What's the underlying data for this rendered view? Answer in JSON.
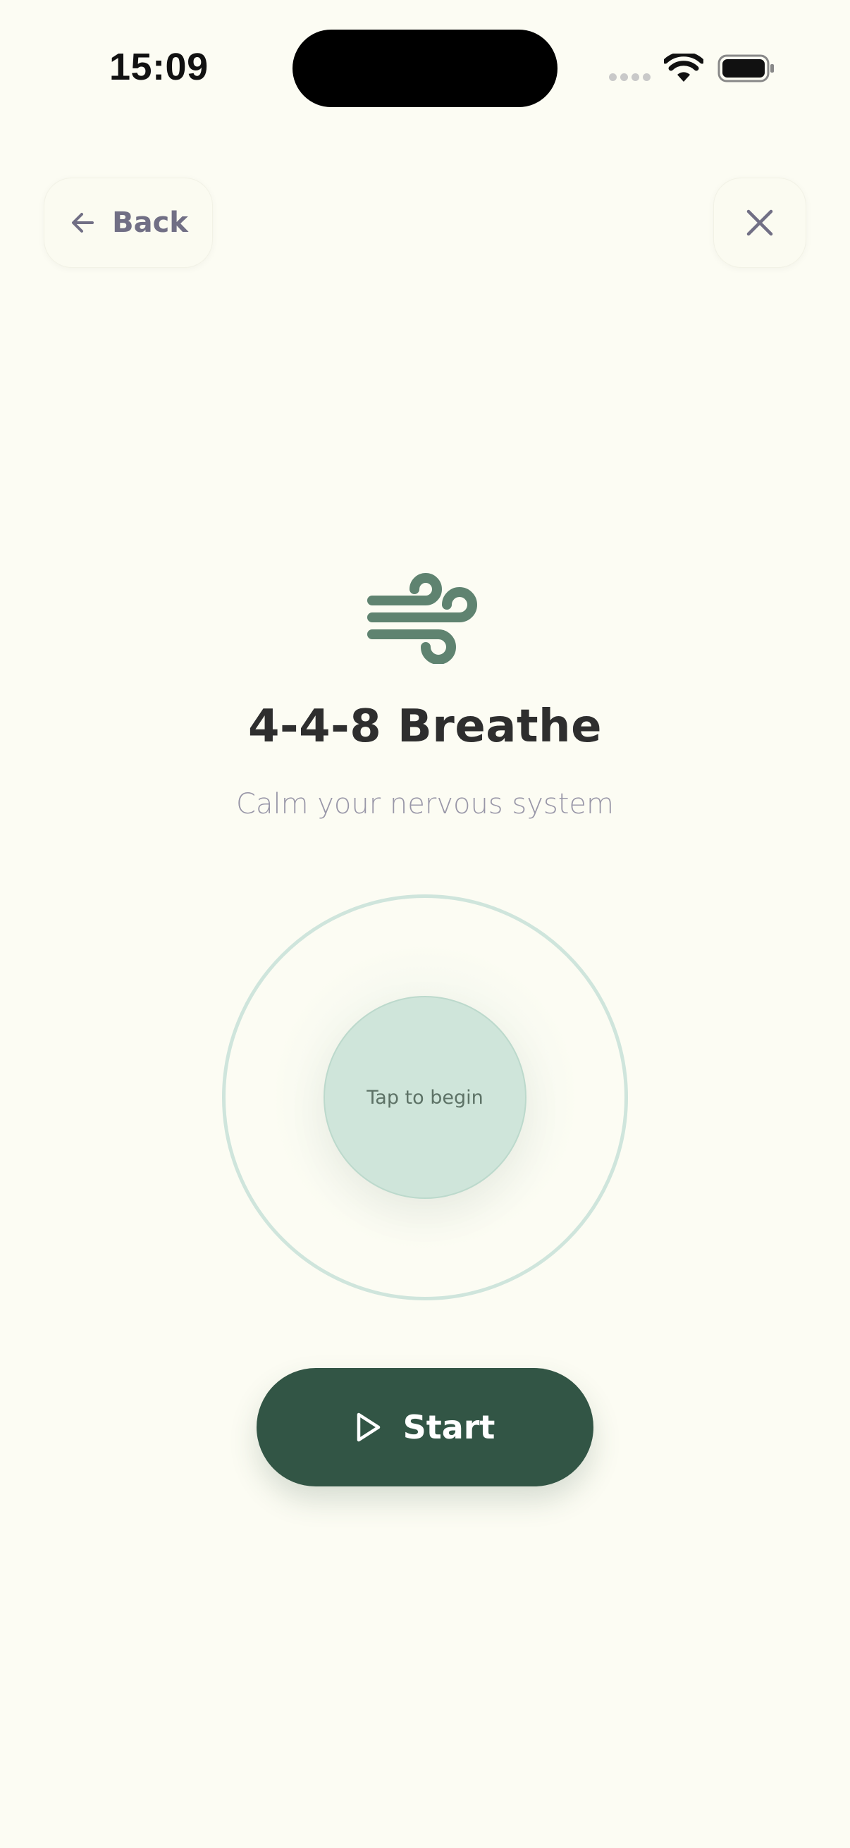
{
  "status_bar": {
    "time": "15:09"
  },
  "header": {
    "back_label": "Back",
    "back_icon": "arrow-left-icon",
    "close_icon": "close-icon"
  },
  "exercise": {
    "icon": "wind-icon",
    "title": "4-4-8 Breathe",
    "subtitle": "Calm your nervous system",
    "circle_label": "Tap to begin"
  },
  "actions": {
    "start_label": "Start",
    "start_icon": "play-icon"
  },
  "colors": {
    "background": "#fcfcf3",
    "primary": "#325545",
    "accent_light": "#cfe5da",
    "icon_green": "#5f8370",
    "muted_text": "#716f85"
  }
}
